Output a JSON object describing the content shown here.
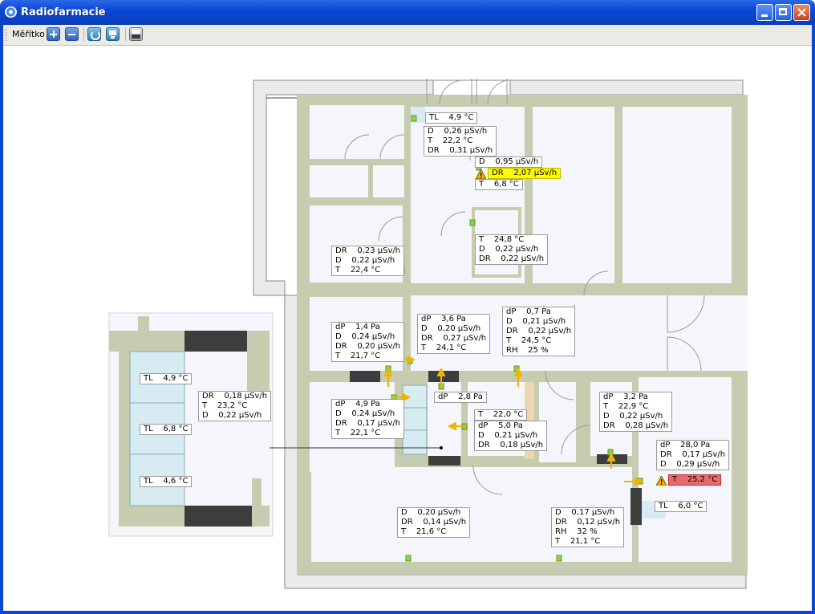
{
  "window": {
    "title": "Radiofarmacie"
  },
  "toolbar": {
    "scale_label": "Měřítko",
    "buttons": [
      {
        "name": "zoom-in",
        "icon": "plus-icon"
      },
      {
        "name": "zoom-out",
        "icon": "minus-icon"
      },
      {
        "name": "refresh",
        "icon": "refresh-icon"
      },
      {
        "name": "save",
        "icon": "save-icon"
      },
      {
        "name": "print",
        "icon": "print-icon"
      }
    ]
  },
  "colors": {
    "wall": "#c5ccb0",
    "room": "#f4f6fb",
    "cold": "#d7ebf2",
    "alarm_yellow": "#fffb00",
    "alarm_red": "#e86a6a",
    "sensor": "#8fd24a",
    "arrow": "#f0b400"
  },
  "readings": [
    {
      "id": "r1",
      "lines": [
        "TL    4,9 °C"
      ]
    },
    {
      "id": "r2",
      "lines": [
        "D    0,26 μSv/h",
        "T    22,2 °C",
        "DR    0,31 μSv/h"
      ]
    },
    {
      "id": "r3",
      "lines": [
        "D    0,95 μSv/h"
      ]
    },
    {
      "id": "r3a",
      "lines": [
        "DR    2,07 μSv/h"
      ],
      "alarm": "yellow"
    },
    {
      "id": "r3b",
      "lines": [
        "T    6,8 °C"
      ]
    },
    {
      "id": "r4",
      "lines": [
        "DR    0,23 μSv/h",
        "D    0,22 μSv/h",
        "T    22,4 °C"
      ]
    },
    {
      "id": "r5",
      "lines": [
        "T    24,8 °C",
        "D    0,22 μSv/h",
        "DR    0,22 μSv/h"
      ]
    },
    {
      "id": "r6",
      "lines": [
        "dP    1,4 Pa",
        "D    0,24 μSv/h",
        "DR    0,20 μSv/h",
        "T    21,7 °C"
      ]
    },
    {
      "id": "r7",
      "lines": [
        "dP    3,6 Pa",
        "D    0,20 μSv/h",
        "DR    0,27 μSv/h",
        "T    24,1 °C"
      ]
    },
    {
      "id": "r8",
      "lines": [
        "dP    0,7 Pa",
        "D    0,21 μSv/h",
        "DR    0,22 μSv/h",
        "T    24,5 °C",
        "RH    25 %"
      ]
    },
    {
      "id": "r9",
      "lines": [
        "dP    4,9 Pa",
        "D    0,24 μSv/h",
        "DR    0,17 μSv/h",
        "T    22,1 °C"
      ]
    },
    {
      "id": "r10",
      "lines": [
        "dP    2,8 Pa"
      ]
    },
    {
      "id": "r11",
      "lines": [
        "T    22,0 °C"
      ]
    },
    {
      "id": "r12",
      "lines": [
        "dP    5,0 Pa",
        "D    0,21 μSv/h",
        "DR    0,18 μSv/h"
      ]
    },
    {
      "id": "r13",
      "lines": [
        "dP    3,2 Pa",
        "T    22,9 °C",
        "D    0,22 μSv/h",
        "DR    0,28 μSv/h"
      ]
    },
    {
      "id": "r14",
      "lines": [
        "dP    28,0 Pa",
        "DR    0,17 μSv/h",
        "D    0,29 μSv/h"
      ]
    },
    {
      "id": "r14a",
      "lines": [
        "T    25,2 °C"
      ],
      "alarm": "red"
    },
    {
      "id": "r15",
      "lines": [
        "TL    6,0 °C"
      ]
    },
    {
      "id": "r16",
      "lines": [
        "D    0,20 μSv/h",
        "DR    0,14 μSv/h",
        "T    21,6 °C"
      ]
    },
    {
      "id": "r17",
      "lines": [
        "D    0,17 μSv/h",
        "DR    0,12 μSv/h",
        "RH    32 %",
        "T    21,1 °C"
      ]
    },
    {
      "id": "r18",
      "lines": [
        "TL    4,9 °C"
      ]
    },
    {
      "id": "r19",
      "lines": [
        "TL    6,8 °C"
      ]
    },
    {
      "id": "r20",
      "lines": [
        "TL    4,6 °C"
      ]
    },
    {
      "id": "r21",
      "lines": [
        "DR    0,18 μSv/h",
        "T    23,2 °C",
        "D    0,22 μSv/h"
      ]
    }
  ]
}
